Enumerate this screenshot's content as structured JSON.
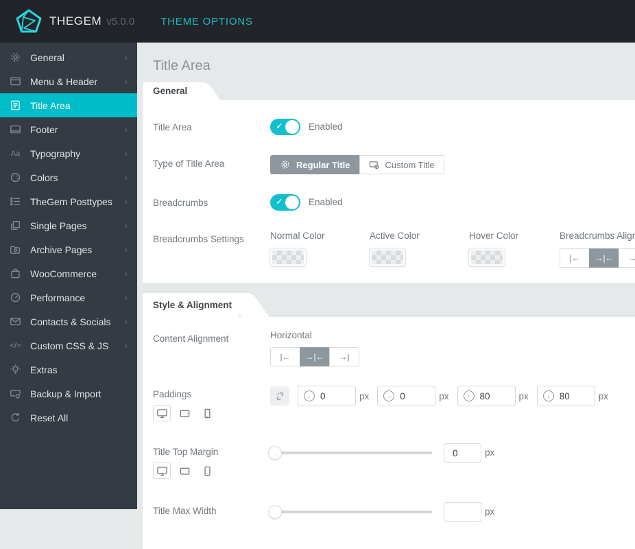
{
  "header": {
    "brand": "THEGEM",
    "version": "v5.0.0",
    "nav": "THEME OPTIONS"
  },
  "sidebar": {
    "items": [
      {
        "label": "General",
        "icon": "gear-icon",
        "chevron": true,
        "active": false
      },
      {
        "label": "Menu & Header",
        "icon": "window-icon",
        "chevron": true,
        "active": false
      },
      {
        "label": "Title Area",
        "icon": "document-icon",
        "chevron": false,
        "active": true
      },
      {
        "label": "Footer",
        "icon": "footer-icon",
        "chevron": true,
        "active": false
      },
      {
        "label": "Typography",
        "icon": "typography-icon",
        "chevron": true,
        "active": false
      },
      {
        "label": "Colors",
        "icon": "palette-icon",
        "chevron": true,
        "active": false
      },
      {
        "label": "TheGem Posttypes",
        "icon": "list-icon",
        "chevron": true,
        "active": false
      },
      {
        "label": "Single Pages",
        "icon": "pages-icon",
        "chevron": true,
        "active": false
      },
      {
        "label": "Archive Pages",
        "icon": "folder-icon",
        "chevron": true,
        "active": false
      },
      {
        "label": "WooCommerce",
        "icon": "bag-icon",
        "chevron": true,
        "active": false
      },
      {
        "label": "Performance",
        "icon": "speedometer-icon",
        "chevron": true,
        "active": false
      },
      {
        "label": "Contacts & Socials",
        "icon": "envelope-icon",
        "chevron": true,
        "active": false
      },
      {
        "label": "Custom CSS & JS",
        "icon": "code-icon",
        "chevron": true,
        "active": false
      },
      {
        "label": "Extras",
        "icon": "lightbulb-icon",
        "chevron": false,
        "active": false
      },
      {
        "label": "Backup & Import",
        "icon": "backup-icon",
        "chevron": false,
        "active": false
      },
      {
        "label": "Reset All",
        "icon": "reset-icon",
        "chevron": false,
        "active": false
      }
    ],
    "chevron_glyph": "›"
  },
  "page": {
    "title": "Title Area"
  },
  "alignment_icons": {
    "left": "|←",
    "center": "→|←",
    "right": "→|"
  },
  "general": {
    "tab": "General",
    "title_area": {
      "label": "Title Area",
      "state": "Enabled"
    },
    "type": {
      "label": "Type of Title Area",
      "regular": "Regular Title",
      "custom": "Custom Title"
    },
    "breadcrumbs": {
      "label": "Breadcrumbs",
      "state": "Enabled"
    },
    "bc": {
      "label": "Breadcrumbs Settings",
      "normal": "Normal Color",
      "active": "Active Color",
      "hover": "Hover Color",
      "alignment": "Breadcrumbs Alignment"
    }
  },
  "style": {
    "tab": "Style & Alignment",
    "content_alignment": {
      "label": "Content Alignment",
      "sub": "Horizontal"
    },
    "paddings": {
      "label": "Paddings",
      "left": "0",
      "right": "0",
      "top": "80",
      "bottom": "80",
      "unit": "px"
    },
    "title_top_margin": {
      "label": "Title Top Margin",
      "value": "0",
      "unit": "px"
    },
    "title_max_width": {
      "label": "Title Max Width",
      "value": "",
      "unit": "px"
    }
  },
  "colors": {
    "accent": "#00bdca",
    "toggle": "#13bfcc",
    "topbar_bg": "#212429",
    "sidebar_bg": "#343b42",
    "active_button": "#8e979e",
    "content_bg": "#e6e9ea"
  }
}
